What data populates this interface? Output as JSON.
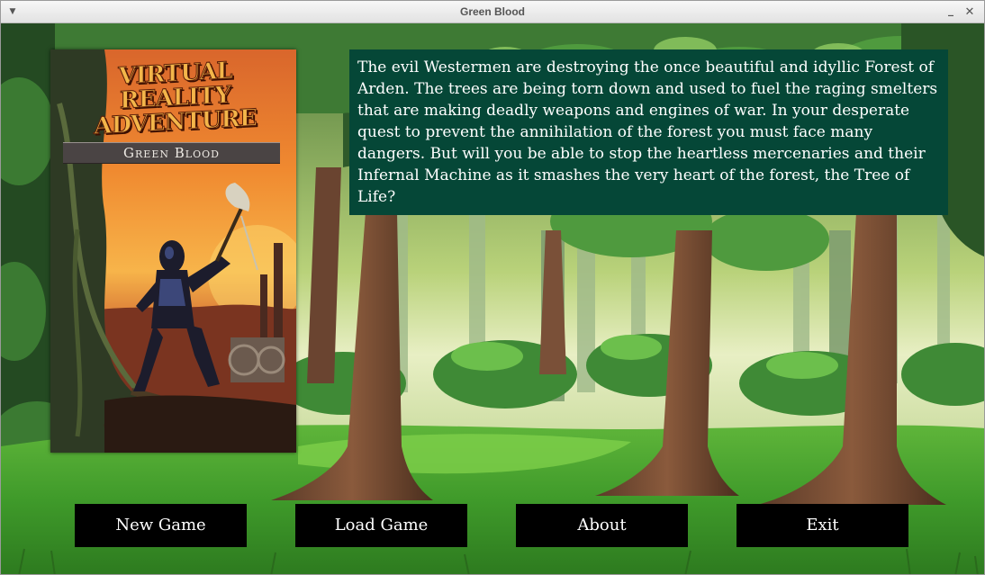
{
  "window": {
    "title": "Green Blood",
    "menu_icon": "dropdown-arrow-icon",
    "minimize_icon": "minimize-icon",
    "close_icon": "close-icon"
  },
  "cover": {
    "series": "Virtual Reality Adventure",
    "title": "Green Blood"
  },
  "description": "The evil Westermen are destroying the once beautiful and idyllic Forest of Arden. The trees are being torn down and used to fuel the raging smelters that are making deadly weapons and engines of war. In your desperate quest to prevent the annihilation of the forest you must face many dangers. But will you be able to stop the heartless mercenaries and their Infernal Machine as it smashes the very heart of the forest, the Tree of Life?",
  "buttons": {
    "new_game": "New Game",
    "load_game": "Load Game",
    "about": "About",
    "exit": "Exit"
  },
  "colors": {
    "description_bg": "#054737",
    "button_bg": "#000000",
    "button_text": "#ffffff"
  }
}
